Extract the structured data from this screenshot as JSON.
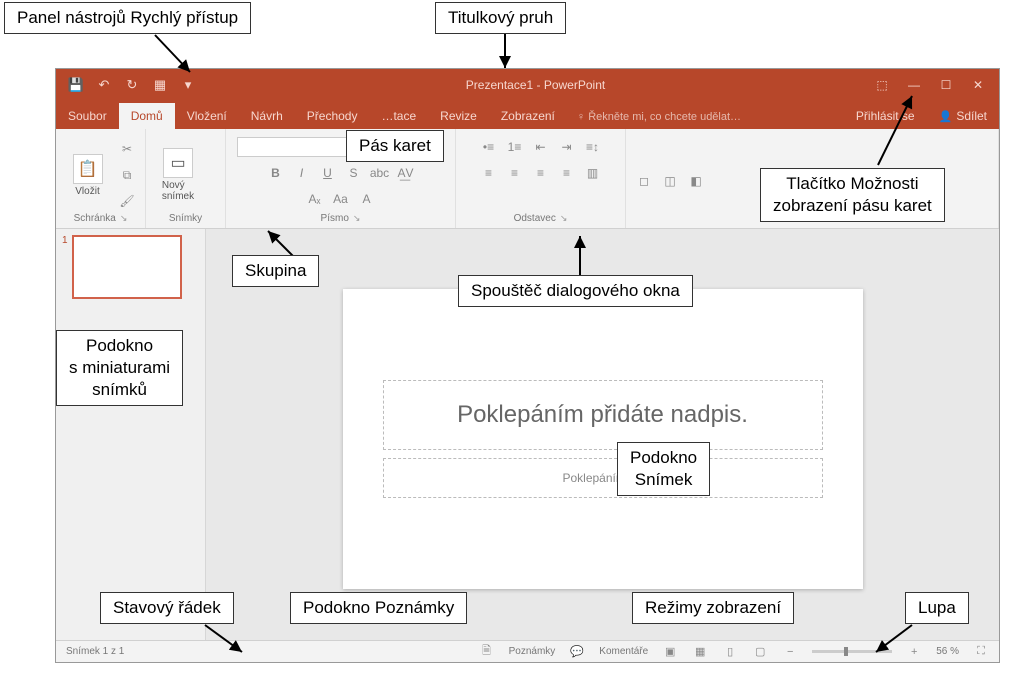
{
  "callouts": {
    "qat": "Panel nástrojů Rychlý přístup",
    "titlebar": "Titulkový pruh",
    "ribbon": "Pás karet",
    "ribbondisplay": "Tlačítko Možnosti\nzobrazení pásu karet",
    "group": "Skupina",
    "launcher": "Spouštěč dialogového okna",
    "thumbs": "Podokno\ns miniaturami\nsnímků",
    "slidepane": "Podokno\nSnímek",
    "statusbar": "Stavový řádek",
    "notes": "Podokno Poznámky",
    "viewmodes": "Režimy zobrazení",
    "zoom": "Lupa"
  },
  "title": "Prezentace1 - PowerPoint",
  "tabs": {
    "file": "Soubor",
    "home": "Domů",
    "insert": "Vložení",
    "design": "Návrh",
    "transitions": "Přechody",
    "animations": "…",
    "slideshow": "…tace",
    "review": "Revize",
    "view": "Zobrazení",
    "tellme": "Řekněte mi, co chcete udělat…",
    "signin": "Přihlásit se",
    "share": "Sdílet"
  },
  "ribbon": {
    "paste": "Vložit",
    "clipboard": "Schránka",
    "newslide": "Nový\nsnímek",
    "slides": "Snímky",
    "font": "Písmo",
    "paragraph": "Odstavec"
  },
  "slide": {
    "title_ph": "Poklepáním přidáte nadpis.",
    "sub_ph": "Poklepáním při"
  },
  "status": {
    "slidecount": "Snímek 1 z 1",
    "notes": "Poznámky",
    "comments": "Komentáře",
    "zoom": "56 %"
  },
  "thumb_number": "1"
}
